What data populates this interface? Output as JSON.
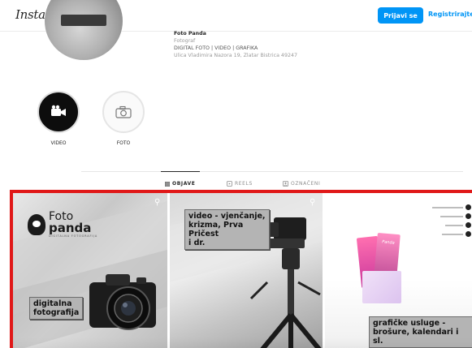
{
  "header": {
    "logo": "Instagram",
    "login_button": "Prijavi se",
    "signup_link": "Registrirajte s"
  },
  "profile": {
    "name": "Foto Panda",
    "category": "Fotograf",
    "bio": "DIGITAL FOTO | VIDEO | GRAFIKA",
    "address": "Ulica Vladimira Nazora 19, Zlatar Bistrica 49247"
  },
  "highlights": [
    {
      "label": "VIDEO",
      "icon": "video-camera-icon"
    },
    {
      "label": "FOTO",
      "icon": "camera-icon"
    }
  ],
  "tabs": [
    {
      "label": "OBJAVE",
      "icon": "grid-icon",
      "active": true
    },
    {
      "label": "REELS",
      "icon": "reels-icon",
      "active": false
    },
    {
      "label": "OZNAČENI",
      "icon": "tagged-icon",
      "active": false
    }
  ],
  "posts": [
    {
      "logo_line1": "Foto",
      "logo_line2": "panda",
      "logo_line3": "DIGITALNA FOTOGRAFIJA",
      "caption_line1": "digitalna",
      "caption_line2": "fotografija"
    },
    {
      "caption_line1": "video - vjenčanje,",
      "caption_line2": "krizma, Prva",
      "caption_line3": "Pričest",
      "caption_line4": "i dr."
    },
    {
      "brochure_text": "Panda",
      "caption_line1": "grafičke usluge -",
      "caption_line2": "brošure, kalendari i sl."
    }
  ],
  "colors": {
    "accent": "#0095f6",
    "highlight_border": "#e01818"
  }
}
